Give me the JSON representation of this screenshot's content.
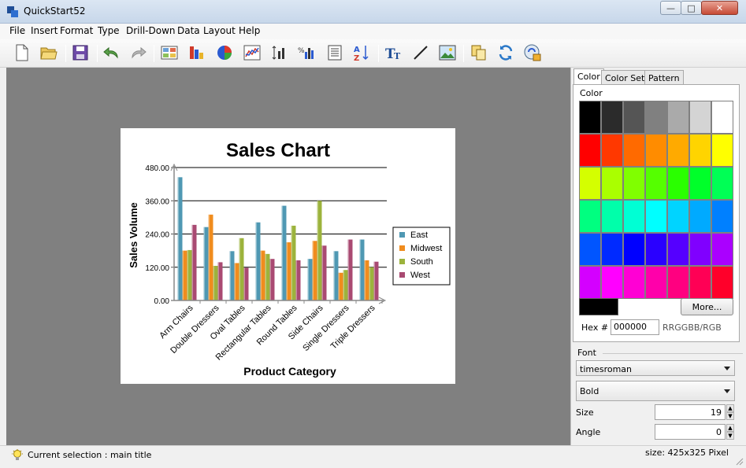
{
  "window": {
    "title": "QuickStart52"
  },
  "menu": [
    "File",
    "Insert",
    "Format",
    "Type",
    "Drill-Down",
    "Data",
    "Layout",
    "Help"
  ],
  "toolbar": {
    "buttons": [
      {
        "name": "new-icon"
      },
      {
        "name": "open-folder-icon"
      },
      {
        "name": "save-icon"
      },
      {
        "name": "undo-icon"
      },
      {
        "name": "redo-icon"
      },
      {
        "name": "chart-type-icon"
      },
      {
        "name": "chart-bar-color-icon"
      },
      {
        "name": "color-pie-icon"
      },
      {
        "name": "line-chart-icon"
      },
      {
        "name": "data-axis-icon"
      },
      {
        "name": "number-format-icon"
      },
      {
        "name": "list-icon"
      },
      {
        "name": "sort-az-icon"
      },
      {
        "name": "text-format-icon"
      },
      {
        "name": "draw-line-icon"
      },
      {
        "name": "insert-image-icon"
      },
      {
        "name": "copy-icon"
      },
      {
        "name": "refresh-icon"
      },
      {
        "name": "export-icon"
      }
    ]
  },
  "chart_data": {
    "type": "bar",
    "title": "Sales Chart",
    "xlabel": "Product Category",
    "ylabel": "Sales Volume",
    "ylim": [
      0,
      480
    ],
    "yticks": [
      "0.00",
      "120.00",
      "240.00",
      "360.00",
      "480.00"
    ],
    "ytick_values": [
      0,
      120,
      240,
      360,
      480
    ],
    "grid": true,
    "legend_position": "right",
    "categories": [
      "Arm Chairs",
      "Double Dressers",
      "Oval Tables",
      "Rectangular Tables",
      "Round Tables",
      "Side Chairs",
      "Single Dressers",
      "Triple Dressers"
    ],
    "series": [
      {
        "name": "East",
        "color": "#4f98b3",
        "values": [
          445,
          265,
          178,
          282,
          342,
          150,
          178,
          220
        ]
      },
      {
        "name": "Midwest",
        "color": "#f08c1e",
        "values": [
          180,
          310,
          135,
          180,
          210,
          215,
          100,
          145
        ]
      },
      {
        "name": "South",
        "color": "#9cb33c",
        "values": [
          182,
          125,
          225,
          168,
          270,
          360,
          110,
          120
        ]
      },
      {
        "name": "West",
        "color": "#a94a72",
        "values": [
          273,
          138,
          118,
          150,
          145,
          198,
          220,
          140
        ]
      }
    ]
  },
  "panel": {
    "tabs": [
      "Color",
      "Color Set",
      "Pattern"
    ],
    "color_group_label": "Color",
    "palette": [
      [
        "#000000",
        "#2b2b2b",
        "#555555",
        "#808080",
        "#aaaaaa",
        "#d4d4d4",
        "#ffffff"
      ],
      [
        "#ff0000",
        "#ff3800",
        "#ff6a00",
        "#ff8c00",
        "#ffaa00",
        "#ffd400",
        "#ffff00"
      ],
      [
        "#d4ff00",
        "#aaff00",
        "#80ff00",
        "#55ff00",
        "#2aff00",
        "#00ff2a",
        "#00ff55"
      ],
      [
        "#00ff80",
        "#00ffaa",
        "#00ffd4",
        "#00ffff",
        "#00d4ff",
        "#00aaff",
        "#0080ff"
      ],
      [
        "#0055ff",
        "#002aff",
        "#0000ff",
        "#2a00ff",
        "#5500ff",
        "#8000ff",
        "#aa00ff"
      ],
      [
        "#d400ff",
        "#ff00ff",
        "#ff00d4",
        "#ff00aa",
        "#ff0080",
        "#ff0055",
        "#ff002a"
      ]
    ],
    "selected_color": "#000000",
    "more_label": "More...",
    "hex_label": "Hex #",
    "hex_value": "000000",
    "hex_format": "RRGGBB/RGB",
    "font_heading": "Font",
    "font_family": "timesroman",
    "font_style": "Bold",
    "size_label": "Size",
    "size_value": "19",
    "angle_label": "Angle",
    "angle_value": "0"
  },
  "status": {
    "selection": "Current selection : main title",
    "size": "size: 425x325 Pixel"
  }
}
